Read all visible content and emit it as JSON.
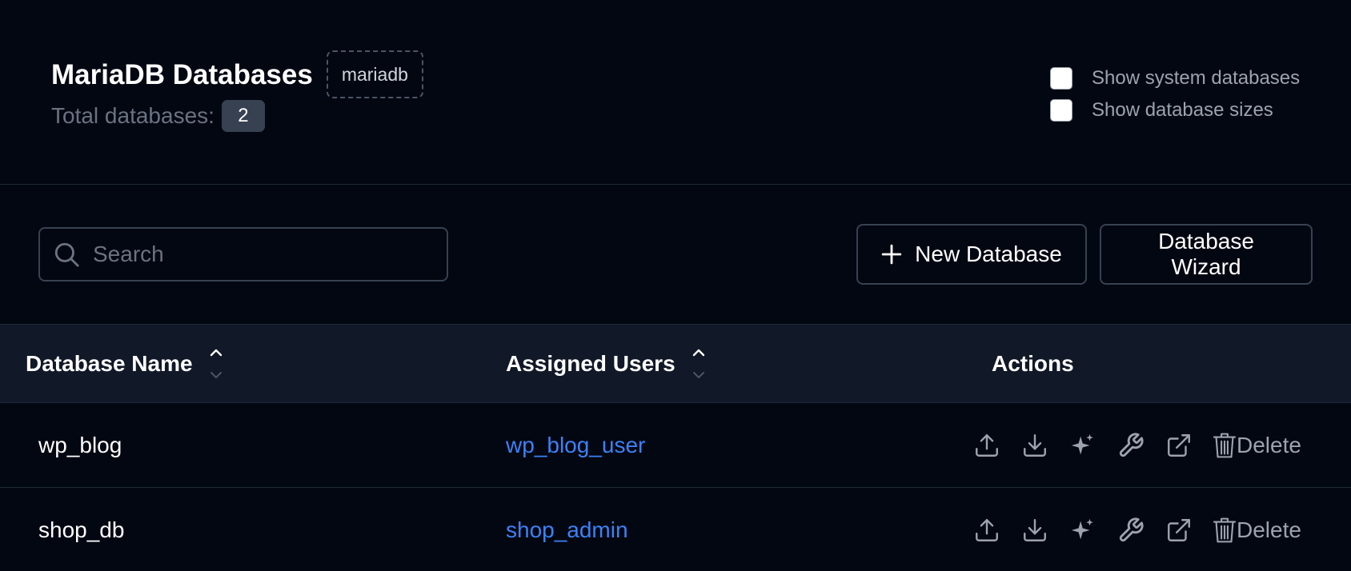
{
  "header": {
    "title": "MariaDB Databases",
    "engine_badge": "mariadb",
    "total_label": "Total databases:",
    "total_count": "2"
  },
  "options": {
    "show_system": {
      "label": "Show system databases",
      "checked": false
    },
    "show_sizes": {
      "label": "Show database sizes",
      "checked": false
    }
  },
  "toolbar": {
    "search_placeholder": "Search",
    "new_database_label": "New Database",
    "wizard_label": "Database Wizard"
  },
  "table": {
    "columns": [
      "Database Name",
      "Assigned Users",
      "Actions"
    ],
    "rows": [
      {
        "name": "wp_blog",
        "user": "wp_blog_user"
      },
      {
        "name": "shop_db",
        "user": "shop_admin"
      }
    ],
    "action_icons": [
      "upload-icon",
      "download-icon",
      "sparkles-icon",
      "wrench-icon",
      "external-link-icon",
      "trash-icon"
    ],
    "delete_label": "Delete"
  },
  "colors": {
    "background": "#030712",
    "header_row": "#111827",
    "link": "#3b82f6",
    "border": "#374151"
  }
}
